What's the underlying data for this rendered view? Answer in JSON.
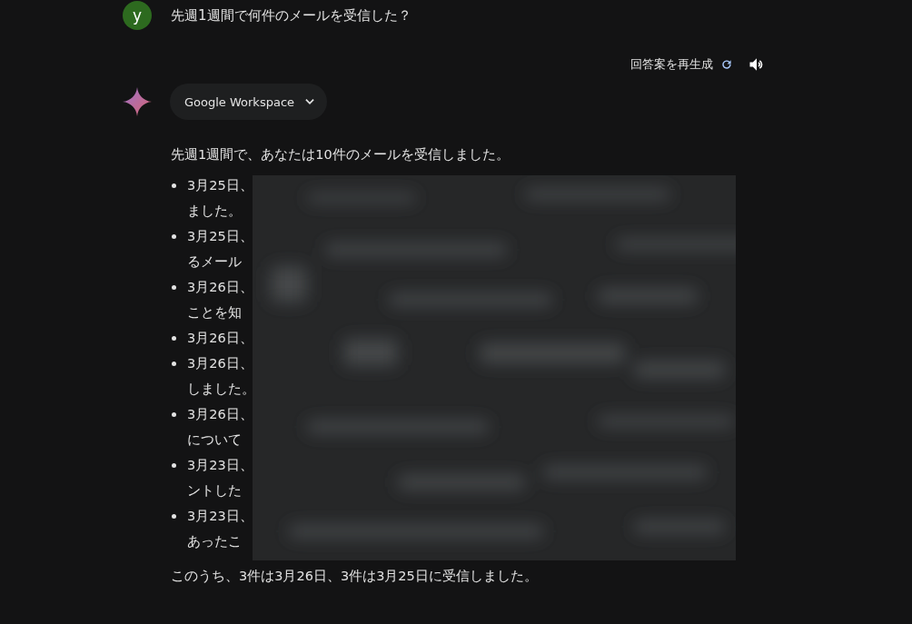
{
  "user_message": {
    "avatar_letter": "y",
    "text": "先週1週間で何件のメールを受信した？"
  },
  "response_actions": {
    "regenerate_label": "回答案を再生成"
  },
  "source_chip": {
    "label": "Google Workspace",
    "expanded": false
  },
  "response": {
    "intro": "先週1週間で、あなたは10件のメールを受信しました。",
    "items": [
      {
        "lines": [
          "3月25日、",
          "ました。"
        ]
      },
      {
        "lines": [
          "3月25日、",
          "るメール"
        ]
      },
      {
        "lines": [
          "3月26日、",
          "ことを知"
        ]
      },
      {
        "lines": [
          "3月26日、"
        ]
      },
      {
        "lines": [
          "3月26日、",
          "しました。"
        ]
      },
      {
        "lines": [
          "3月26日、",
          "について"
        ]
      },
      {
        "lines": [
          "3月23日、",
          "ントした"
        ]
      },
      {
        "lines": [
          "3月23日、",
          "あったこ"
        ]
      }
    ],
    "summary": "このうち、3件は3月26日、3件は3月25日に受信しました。"
  }
}
